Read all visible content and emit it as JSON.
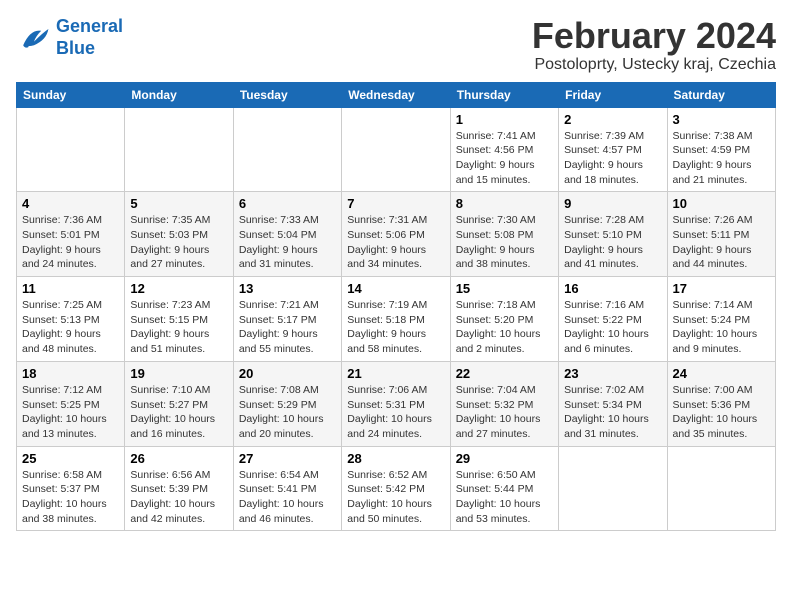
{
  "logo": {
    "line1": "General",
    "line2": "Blue"
  },
  "title": "February 2024",
  "subtitle": "Postoloprty, Ustecky kraj, Czechia",
  "days_of_week": [
    "Sunday",
    "Monday",
    "Tuesday",
    "Wednesday",
    "Thursday",
    "Friday",
    "Saturday"
  ],
  "weeks": [
    [
      {
        "day": "",
        "info": ""
      },
      {
        "day": "",
        "info": ""
      },
      {
        "day": "",
        "info": ""
      },
      {
        "day": "",
        "info": ""
      },
      {
        "day": "1",
        "info": "Sunrise: 7:41 AM\nSunset: 4:56 PM\nDaylight: 9 hours\nand 15 minutes."
      },
      {
        "day": "2",
        "info": "Sunrise: 7:39 AM\nSunset: 4:57 PM\nDaylight: 9 hours\nand 18 minutes."
      },
      {
        "day": "3",
        "info": "Sunrise: 7:38 AM\nSunset: 4:59 PM\nDaylight: 9 hours\nand 21 minutes."
      }
    ],
    [
      {
        "day": "4",
        "info": "Sunrise: 7:36 AM\nSunset: 5:01 PM\nDaylight: 9 hours\nand 24 minutes."
      },
      {
        "day": "5",
        "info": "Sunrise: 7:35 AM\nSunset: 5:03 PM\nDaylight: 9 hours\nand 27 minutes."
      },
      {
        "day": "6",
        "info": "Sunrise: 7:33 AM\nSunset: 5:04 PM\nDaylight: 9 hours\nand 31 minutes."
      },
      {
        "day": "7",
        "info": "Sunrise: 7:31 AM\nSunset: 5:06 PM\nDaylight: 9 hours\nand 34 minutes."
      },
      {
        "day": "8",
        "info": "Sunrise: 7:30 AM\nSunset: 5:08 PM\nDaylight: 9 hours\nand 38 minutes."
      },
      {
        "day": "9",
        "info": "Sunrise: 7:28 AM\nSunset: 5:10 PM\nDaylight: 9 hours\nand 41 minutes."
      },
      {
        "day": "10",
        "info": "Sunrise: 7:26 AM\nSunset: 5:11 PM\nDaylight: 9 hours\nand 44 minutes."
      }
    ],
    [
      {
        "day": "11",
        "info": "Sunrise: 7:25 AM\nSunset: 5:13 PM\nDaylight: 9 hours\nand 48 minutes."
      },
      {
        "day": "12",
        "info": "Sunrise: 7:23 AM\nSunset: 5:15 PM\nDaylight: 9 hours\nand 51 minutes."
      },
      {
        "day": "13",
        "info": "Sunrise: 7:21 AM\nSunset: 5:17 PM\nDaylight: 9 hours\nand 55 minutes."
      },
      {
        "day": "14",
        "info": "Sunrise: 7:19 AM\nSunset: 5:18 PM\nDaylight: 9 hours\nand 58 minutes."
      },
      {
        "day": "15",
        "info": "Sunrise: 7:18 AM\nSunset: 5:20 PM\nDaylight: 10 hours\nand 2 minutes."
      },
      {
        "day": "16",
        "info": "Sunrise: 7:16 AM\nSunset: 5:22 PM\nDaylight: 10 hours\nand 6 minutes."
      },
      {
        "day": "17",
        "info": "Sunrise: 7:14 AM\nSunset: 5:24 PM\nDaylight: 10 hours\nand 9 minutes."
      }
    ],
    [
      {
        "day": "18",
        "info": "Sunrise: 7:12 AM\nSunset: 5:25 PM\nDaylight: 10 hours\nand 13 minutes."
      },
      {
        "day": "19",
        "info": "Sunrise: 7:10 AM\nSunset: 5:27 PM\nDaylight: 10 hours\nand 16 minutes."
      },
      {
        "day": "20",
        "info": "Sunrise: 7:08 AM\nSunset: 5:29 PM\nDaylight: 10 hours\nand 20 minutes."
      },
      {
        "day": "21",
        "info": "Sunrise: 7:06 AM\nSunset: 5:31 PM\nDaylight: 10 hours\nand 24 minutes."
      },
      {
        "day": "22",
        "info": "Sunrise: 7:04 AM\nSunset: 5:32 PM\nDaylight: 10 hours\nand 27 minutes."
      },
      {
        "day": "23",
        "info": "Sunrise: 7:02 AM\nSunset: 5:34 PM\nDaylight: 10 hours\nand 31 minutes."
      },
      {
        "day": "24",
        "info": "Sunrise: 7:00 AM\nSunset: 5:36 PM\nDaylight: 10 hours\nand 35 minutes."
      }
    ],
    [
      {
        "day": "25",
        "info": "Sunrise: 6:58 AM\nSunset: 5:37 PM\nDaylight: 10 hours\nand 38 minutes."
      },
      {
        "day": "26",
        "info": "Sunrise: 6:56 AM\nSunset: 5:39 PM\nDaylight: 10 hours\nand 42 minutes."
      },
      {
        "day": "27",
        "info": "Sunrise: 6:54 AM\nSunset: 5:41 PM\nDaylight: 10 hours\nand 46 minutes."
      },
      {
        "day": "28",
        "info": "Sunrise: 6:52 AM\nSunset: 5:42 PM\nDaylight: 10 hours\nand 50 minutes."
      },
      {
        "day": "29",
        "info": "Sunrise: 6:50 AM\nSunset: 5:44 PM\nDaylight: 10 hours\nand 53 minutes."
      },
      {
        "day": "",
        "info": ""
      },
      {
        "day": "",
        "info": ""
      }
    ]
  ]
}
